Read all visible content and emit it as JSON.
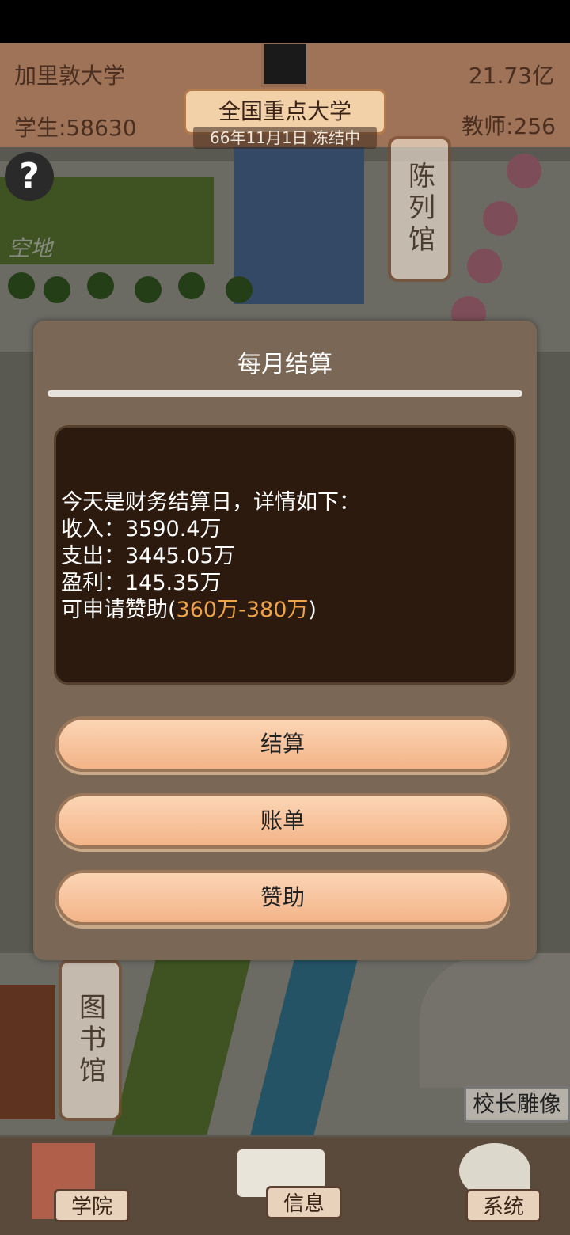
{
  "header": {
    "university_name": "加里敦大学",
    "funds": "21.73亿",
    "students": "学生:58630",
    "teachers": "教师:256",
    "rank_title": "全国重点大学",
    "date_status": "66年11月1日 冻结中"
  },
  "map": {
    "help_glyph": "?",
    "empty_lot_label": "空地",
    "exhibition_hall_label": "陈列馆",
    "library_label": "图书馆",
    "statue_label": "校长雕像"
  },
  "dialog": {
    "title": "每月结算",
    "lines": {
      "intro": "今天是财务结算日，详情如下：",
      "income": "收入：3590.4万",
      "expense": "支出：3445.05万",
      "profit": "盈利：145.35万",
      "sponsor_prefix": "可申请赞助(",
      "sponsor_range_low": "360万",
      "sponsor_dash": "-",
      "sponsor_range_high": "380万",
      "sponsor_suffix": ")"
    },
    "buttons": {
      "settle": "结算",
      "bill": "账单",
      "sponsor": "赞助"
    }
  },
  "bottom_nav": {
    "college": "学院",
    "info": "信息",
    "system": "系统"
  },
  "colors": {
    "dialog_bg": "#7b6756",
    "panel_bg": "#2c1a0f",
    "highlight": "#f0a44a",
    "button_fill": "#f3b488"
  }
}
